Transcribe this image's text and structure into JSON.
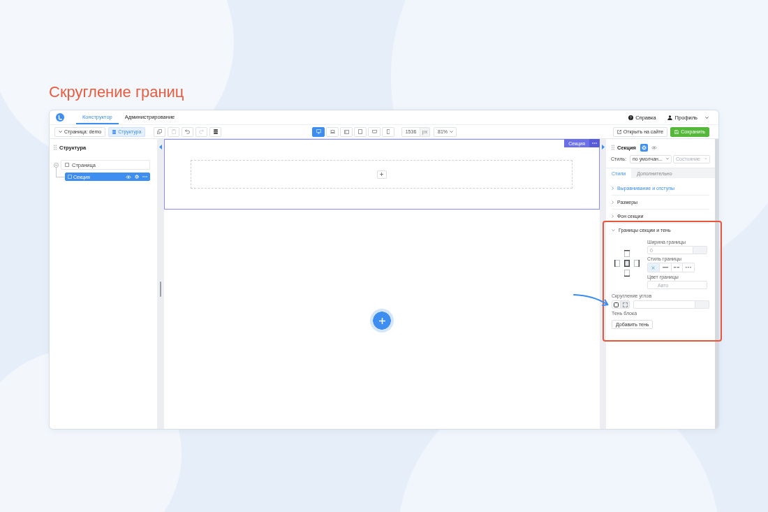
{
  "heading": "Скругление границ",
  "top_nav": {
    "tabs": [
      {
        "label": "Конструктор",
        "selected": true
      },
      {
        "label": "Администрирование",
        "selected": false
      }
    ],
    "help": "Справка",
    "profile": "Профиль"
  },
  "toolbar": {
    "page_select": "Страница: demo",
    "structure_button": {
      "label": "Структура",
      "selected": true
    },
    "actions": [
      {
        "kind": "copy",
        "disabled": false
      },
      {
        "kind": "paste",
        "disabled": true
      },
      {
        "kind": "undo",
        "disabled": false
      },
      {
        "kind": "redo",
        "disabled": true
      },
      {
        "kind": "stack",
        "disabled": false
      }
    ],
    "devices": [
      {
        "kind": "desktop",
        "selected": true
      },
      {
        "kind": "laptop",
        "selected": false
      },
      {
        "kind": "tablet_landscape",
        "selected": false
      },
      {
        "kind": "tablet",
        "selected": false
      },
      {
        "kind": "phone_landscape",
        "selected": false
      },
      {
        "kind": "phone",
        "selected": false
      }
    ],
    "width": {
      "value": "1536",
      "unit": "px"
    },
    "zoom": "81%",
    "open_site": "Открыть на сайте",
    "save": "Сохранить"
  },
  "structure_panel": {
    "title": "Структура",
    "tree": [
      {
        "label": "Страница",
        "expanded": true,
        "selected": false,
        "children": [
          {
            "label": "Секция",
            "selected": true
          }
        ]
      }
    ]
  },
  "canvas": {
    "section": {
      "badge": "Секция",
      "selected": true
    }
  },
  "inspector": {
    "title": "Секция",
    "style_label": "Стиль:",
    "style_value": "по умолчан...",
    "state_placeholder": "Состояние",
    "tabs": [
      {
        "label": "Стили",
        "selected": true
      },
      {
        "label": "Дополнительно",
        "selected": false
      }
    ],
    "groups": [
      {
        "label": "Выравнивание и отступы",
        "expanded": false,
        "highlighted": true
      },
      {
        "label": "Размеры",
        "expanded": false,
        "highlighted": false
      },
      {
        "label": "Фон секции",
        "expanded": false,
        "highlighted": false
      },
      {
        "label": "Границы секции и тень",
        "expanded": true,
        "highlighted": false,
        "content": {
          "sides": [
            {
              "kind": "top",
              "selected": false
            },
            {
              "kind": "left",
              "selected": false
            },
            {
              "kind": "all",
              "selected": true
            },
            {
              "kind": "right",
              "selected": false
            },
            {
              "kind": "bottom",
              "selected": false
            }
          ],
          "width_label": "Ширина границы",
          "width_placeholder": "0",
          "style_label": "Стиль границы",
          "styles": [
            {
              "kind": "none",
              "selected": true
            },
            {
              "kind": "solid",
              "selected": false
            },
            {
              "kind": "dashed",
              "selected": false
            },
            {
              "kind": "dotted",
              "selected": false
            }
          ],
          "color_label": "Цвет границы",
          "color_placeholder": "Авто",
          "radius_label": "Скругление углов",
          "radius_modes": [
            {
              "kind": "all",
              "selected": true
            },
            {
              "kind": "individual",
              "selected": false
            }
          ],
          "shadow_label": "Тень блока",
          "shadow_button": "Добавить тень"
        }
      }
    ]
  }
}
